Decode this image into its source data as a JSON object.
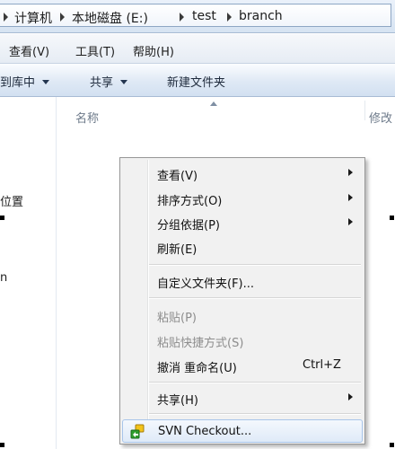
{
  "breadcrumb": {
    "items": [
      "计算机",
      "本地磁盘 (E:)",
      "test",
      "branch"
    ]
  },
  "menubar": {
    "items": [
      "查看(V)",
      "工具(T)",
      "帮助(H)"
    ]
  },
  "toolbar": {
    "items": [
      {
        "label": "到库中",
        "has_dropdown": true
      },
      {
        "label": "共享",
        "has_dropdown": true
      },
      {
        "label": "新建文件夹",
        "has_dropdown": false
      }
    ]
  },
  "navpane": {
    "items": [
      "位置",
      "n"
    ]
  },
  "content": {
    "columns": [
      "名称",
      "修改"
    ]
  },
  "context_menu": {
    "items": [
      {
        "label": "查看(V)",
        "submenu": true,
        "disabled": false
      },
      {
        "label": "排序方式(O)",
        "submenu": true,
        "disabled": false
      },
      {
        "label": "分组依据(P)",
        "submenu": true,
        "disabled": false
      },
      {
        "label": "刷新(E)",
        "submenu": false,
        "disabled": false
      },
      {
        "label": "自定义文件夹(F)...",
        "submenu": false,
        "disabled": false
      },
      {
        "label": "粘贴(P)",
        "submenu": false,
        "disabled": true
      },
      {
        "label": "粘贴快捷方式(S)",
        "submenu": false,
        "disabled": true
      },
      {
        "label": "撤消 重命名(U)",
        "shortcut": "Ctrl+Z",
        "submenu": false,
        "disabled": false
      },
      {
        "label": "共享(H)",
        "submenu": true,
        "disabled": false
      },
      {
        "label": "SVN Checkout...",
        "submenu": false,
        "disabled": false,
        "highlighted": true,
        "icon": "svn-icon"
      }
    ]
  },
  "colors": {
    "menu_bg": "#f1f1f1",
    "highlight_border": "#a8c5ea",
    "disabled_text": "#8d8d8d",
    "svn_green": "#2e9e2e",
    "svn_yellow": "#f2c31a"
  }
}
